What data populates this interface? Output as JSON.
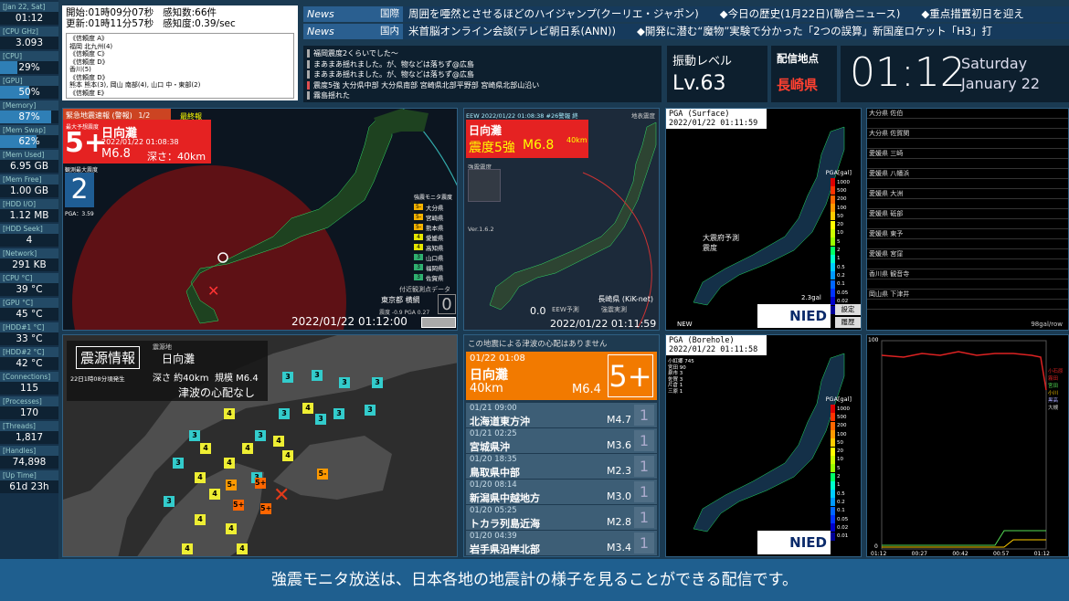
{
  "stats": [
    {
      "label": "[Jan 22, Sat]",
      "value": "01:12",
      "bar": 0
    },
    {
      "label": "[CPU GHz]",
      "value": "3.093",
      "bar": 0
    },
    {
      "label": "[CPU]",
      "value": "29%",
      "bar": 0.29
    },
    {
      "label": "[GPU]",
      "value": "50%",
      "bar": 0.5
    },
    {
      "label": "[Memory]",
      "value": "87%",
      "bar": 0.87
    },
    {
      "label": "[Mem Swap]",
      "value": "62%",
      "bar": 0.62
    },
    {
      "label": "[Mem Used]",
      "value": "6.95 GB",
      "bar": 0
    },
    {
      "label": "[Mem Free]",
      "value": "1.00 GB",
      "bar": 0
    },
    {
      "label": "[HDD I/O]",
      "value": "1.12 MB",
      "bar": 0
    },
    {
      "label": "[HDD Seek]",
      "value": "4",
      "bar": 0
    },
    {
      "label": "[Network]",
      "value": "291 KB",
      "bar": 0
    },
    {
      "label": "[CPU °C]",
      "value": "39 °C",
      "bar": 0
    },
    {
      "label": "[GPU °C]",
      "value": "45 °C",
      "bar": 0
    },
    {
      "label": "[HDD#1 °C]",
      "value": "33 °C",
      "bar": 0
    },
    {
      "label": "[HDD#2 °C]",
      "value": "42 °C",
      "bar": 0
    },
    {
      "label": "[Connections]",
      "value": "115",
      "bar": 0
    },
    {
      "label": "[Processes]",
      "value": "170",
      "bar": 0
    },
    {
      "label": "[Threads]",
      "value": "1,817",
      "bar": 0
    },
    {
      "label": "[Handles]",
      "value": "74,898",
      "bar": 0
    },
    {
      "label": "[Up Time]",
      "value": "61d 23h",
      "bar": 0
    }
  ],
  "eqbox": {
    "start": "開始:01時09分07秒",
    "count": "感知数:66件",
    "update": "更新:01時11分57秒",
    "rate": "感知度:0.39/sec",
    "lines": [
      "《信頼度 A》",
      "福岡 北九州(4)",
      "《信頼度 C》",
      "《信頼度 D》",
      "香川(5)",
      "《信頼度 D》",
      "熊本 熊本(3), 岡山 南部(4), 山口 中・東部(2)",
      "《信頼度 E》"
    ]
  },
  "news": [
    {
      "logo": "News",
      "cat": "国際",
      "text": "周囲を唖然とさせるほどのハイジャンプ(クーリエ・ジャポン)　　◆今日の歴史(1月22日)(聯合ニュース)　　◆重点措置初日を迎え"
    },
    {
      "logo": "News",
      "cat": "国内",
      "text": "米首脳オンライン会談(テレビ朝日系(ANN))　　◆開発に潜む“魔物”実験で分かった「2つの誤算」新国産ロケット「H3」打"
    }
  ],
  "tweets": [
    {
      "text": "福岡震度2くらいでした～",
      "color": "#aaaaaa"
    },
    {
      "text": "まあまあ揺れました。が、物などは落ちず@広島",
      "color": "#aaaaaa"
    },
    {
      "text": "まあまあ揺れました。が、物などは落ちず@広島",
      "color": "#aaaaaa"
    },
    {
      "text": "震度5強 大分県中部 大分県南部 宮崎県北部平野部 宮崎県北部山沿い",
      "color": "#e05050"
    },
    {
      "text": "霧島揺れた",
      "color": "#aaaaaa"
    }
  ],
  "shindo": {
    "label": "振動レベル",
    "value": "Lv.63"
  },
  "haishin": {
    "label": "配信地点",
    "value": "長崎県"
  },
  "clock": {
    "time": "01:12",
    "day": "Saturday",
    "date": "January 22"
  },
  "map1": {
    "header": "緊急地震速報 (警報)",
    "count": "1/2",
    "final": "最終報",
    "maxlbl": "最大予想震度",
    "int": "5+",
    "place": "日向灘",
    "datetime": "2022/01/22 01:08:38",
    "mag": "M6.8",
    "depth": "深さ：40km",
    "obslbl": "観測最大震度",
    "obs": "2",
    "pga": "PGA：3.59",
    "footer": "2022/01/22 01:12:00",
    "point": "東京都 横網",
    "pointval": "0",
    "pointsub": "震度 -0.9  PGA 0.27",
    "near": "付近観測点データ",
    "legend": [
      {
        "s": "5-",
        "p": "大分県",
        "c": "#f5b300"
      },
      {
        "s": "5-",
        "p": "宮崎県",
        "c": "#f5b300"
      },
      {
        "s": "5-",
        "p": "熊本県",
        "c": "#f5b300"
      },
      {
        "s": "4",
        "p": "愛媛県",
        "c": "#e6e600"
      },
      {
        "s": "4",
        "p": "高知県",
        "c": "#e6e600"
      },
      {
        "s": "3",
        "p": "山口県",
        "c": "#30b070"
      },
      {
        "s": "3",
        "p": "福岡県",
        "c": "#30b070"
      },
      {
        "s": "3",
        "p": "佐賀県",
        "c": "#30b070"
      }
    ],
    "legendtitle": "強震モニタ震度"
  },
  "map2": {
    "header": "EEW 2022/01/22 01:08:38 #26警報 終",
    "sub": "地表震度",
    "place": "日向灘",
    "int": "震度5強",
    "mag": "M6.8",
    "depth": "40km",
    "ver": "Ver.1.6.2",
    "lbl": "強震震度",
    "site": "長崎県 (KiK-net)",
    "footer": "2022/01/22 01:11:59",
    "val": "0.0",
    "eew": "EEW予測",
    "obs": "強震実測"
  },
  "map3": {
    "title": "PGA (Surface)",
    "time": "2022/01/22 01:11:59",
    "unit": "PGA[gal]",
    "scale": [
      "1000",
      "500",
      "200",
      "100",
      "50",
      "20",
      "10",
      "5",
      "2",
      "1",
      "0.5",
      "0.2",
      "0.1",
      "0.05",
      "0.02",
      "0.01"
    ],
    "val": "2.3gal",
    "new": "NEW",
    "btn1": "設定",
    "btn2": "履歴",
    "nied": "NIED",
    "label": "大震府予測震度"
  },
  "map4": {
    "title": "PGA (Borehole)",
    "time": "2022/01/22 01:11:58",
    "lines": [
      "小紅郷 745",
      "宮田 90",
      "泉市 3",
      "佐賀 3",
      "片倉 1",
      "三原 1"
    ],
    "unit": "PGA[gal]",
    "nied": "NIED"
  },
  "list1": {
    "rows": [
      "大分県 佐伯",
      "",
      "大分県 佐賀関",
      "",
      "愛媛県 三崎",
      "",
      "愛媛県 八幡浜",
      "",
      "愛媛県 大洲",
      "",
      "愛媛県 砥部",
      "",
      "愛媛県 東予",
      "",
      "愛媛県 宮窪",
      "",
      "香川県 観音寺",
      "",
      "岡山県 下津井",
      ""
    ],
    "foot": "98gal/row"
  },
  "graph": {
    "ymax": "100",
    "ymin": "0",
    "x": [
      "01:12",
      "00:27",
      "00:42",
      "00:57",
      "01:12"
    ],
    "legend": [
      "小石原",
      "霧田",
      "宮田",
      "小川",
      "黒高",
      "大槻"
    ]
  },
  "hypo": {
    "title": "震源情報",
    "lbl": "震源地",
    "place": "日向灘",
    "time": "22日1時08分頃発生",
    "depth": "深さ 約40km",
    "mag": "規模 M6.4",
    "tsunami": "津波の心配なし"
  },
  "eqlist": {
    "note": "この地震による津波の心配はありません",
    "top": {
      "date": "01/22 01:08",
      "place": "日向灘",
      "depth": "40km",
      "mag": "M6.4",
      "int": "5+"
    },
    "rows": [
      {
        "d": "01/21 09:00",
        "n": "北海道東方沖",
        "m": "M4.7",
        "s": "1"
      },
      {
        "d": "01/21 02:25",
        "n": "宮城県沖",
        "m": "M3.6",
        "s": "1"
      },
      {
        "d": "01/20 18:35",
        "n": "鳥取県中部",
        "m": "M2.3",
        "s": "1"
      },
      {
        "d": "01/20 08:14",
        "n": "新潟県中越地方",
        "m": "M3.0",
        "s": "1"
      },
      {
        "d": "01/20 05:25",
        "n": "トカラ列島近海",
        "m": "M2.8",
        "s": "1"
      },
      {
        "d": "01/20 04:39",
        "n": "岩手県沿岸北部",
        "m": "M3.4",
        "s": "1"
      }
    ]
  },
  "footer": "強震モニタ放送は、日本各地の地震計の様子を見ることができる配信です。",
  "colors": {
    "red": "#e52222",
    "orange": "#f27a00",
    "bg": "#1a3a52"
  }
}
